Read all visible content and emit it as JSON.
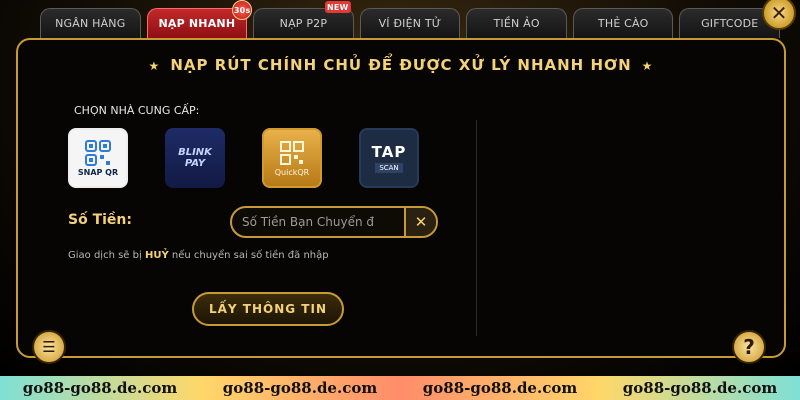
{
  "tabs": [
    {
      "label": "NGÂN HÀNG",
      "active": false,
      "badge": ""
    },
    {
      "label": "NẠP NHANH",
      "active": true,
      "badge": "30s"
    },
    {
      "label": "NẠP P2P",
      "active": false,
      "badge": "NEW"
    },
    {
      "label": "VÍ ĐIỆN TỬ",
      "active": false,
      "badge": ""
    },
    {
      "label": "TIỀN ẢO",
      "active": false,
      "badge": ""
    },
    {
      "label": "THẺ CÀO",
      "active": false,
      "badge": ""
    },
    {
      "label": "GIFTCODE",
      "active": false,
      "badge": ""
    }
  ],
  "close_icon_glyph": "✕",
  "panel": {
    "headline": "NẠP RÚT CHÍNH CHỦ ĐỂ ĐƯỢC XỬ LÝ NHANH HƠN",
    "choose_label": "CHỌN NHÀ CUNG CẤP:",
    "providers": [
      {
        "id": "snap",
        "label": "SNAP QR",
        "icon": "qr-icon"
      },
      {
        "id": "blink",
        "label": "BLINK PAY",
        "icon": "blinkpay-logo"
      },
      {
        "id": "quick",
        "label": "QuickQR",
        "icon": "qr-icon"
      },
      {
        "id": "tap",
        "label": "TAP SCAN",
        "icon": "tapscan-logo"
      }
    ],
    "amount": {
      "label": "Số Tiền:",
      "placeholder": "Số Tiền Bạn Chuyển đ",
      "clear_glyph": "✕"
    },
    "warning": {
      "before": "Giao dịch sẽ bị ",
      "emphasis": "HUỶ",
      "after": " nếu chuyển sai số tiền đã nhập"
    },
    "submit_label": "LẤY THÔNG TIN"
  },
  "corner": {
    "help_glyph": "?",
    "note_glyph": "☰"
  },
  "watermark": [
    "go88-go88.de.com",
    "go88-go88.de.com",
    "go88-go88.de.com",
    "go88-go88.de.com"
  ],
  "colors": {
    "gold": "#f3d27a",
    "active_tab": "#c3282a",
    "border_gold": "#c79a36"
  }
}
